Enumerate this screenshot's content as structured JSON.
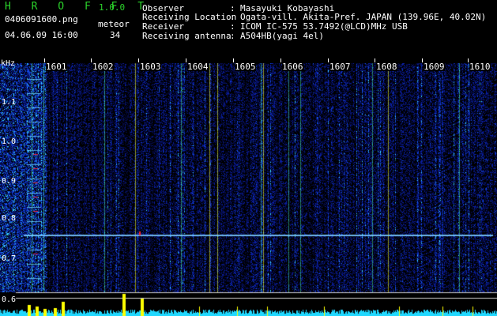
{
  "header": {
    "app_title": "H R O F F T",
    "app_version": "1.0.0",
    "filename": "0406091600.png",
    "datetime": "04.06.09 16:00",
    "meteor_label": "meteor",
    "meteor_count": "34",
    "info": [
      {
        "label": "Observer",
        "value": "Masayuki Kobayashi"
      },
      {
        "label": "Receiving Location",
        "value": "Ogata-vill. Akita-Pref. JAPAN (139.96E, 40.02N)"
      },
      {
        "label": "Receiver",
        "value": "ICOM IC-575 53.7492(@LCD)MHz USB"
      },
      {
        "label": "Receiving antenna",
        "value": "A504HB(yagi 4el)"
      }
    ]
  },
  "axes": {
    "y_unit": "kHz",
    "y_ticks": [
      "1.1",
      "1.0",
      "0.9",
      "0.8",
      "0.7",
      "0.6"
    ],
    "x_ticks": [
      "1601",
      "1602",
      "1603",
      "1604",
      "1605",
      "1606",
      "1607",
      "1608",
      "1609",
      "1610"
    ]
  },
  "colors": {
    "background": "#000000",
    "title_green": "#2bd32b",
    "noise_blue": "#1030c0",
    "signal_cyan": "#20e0ff",
    "signal_yellow": "#ffff00",
    "signal_red": "#ff2020",
    "baseline_white": "#ffffff"
  }
}
